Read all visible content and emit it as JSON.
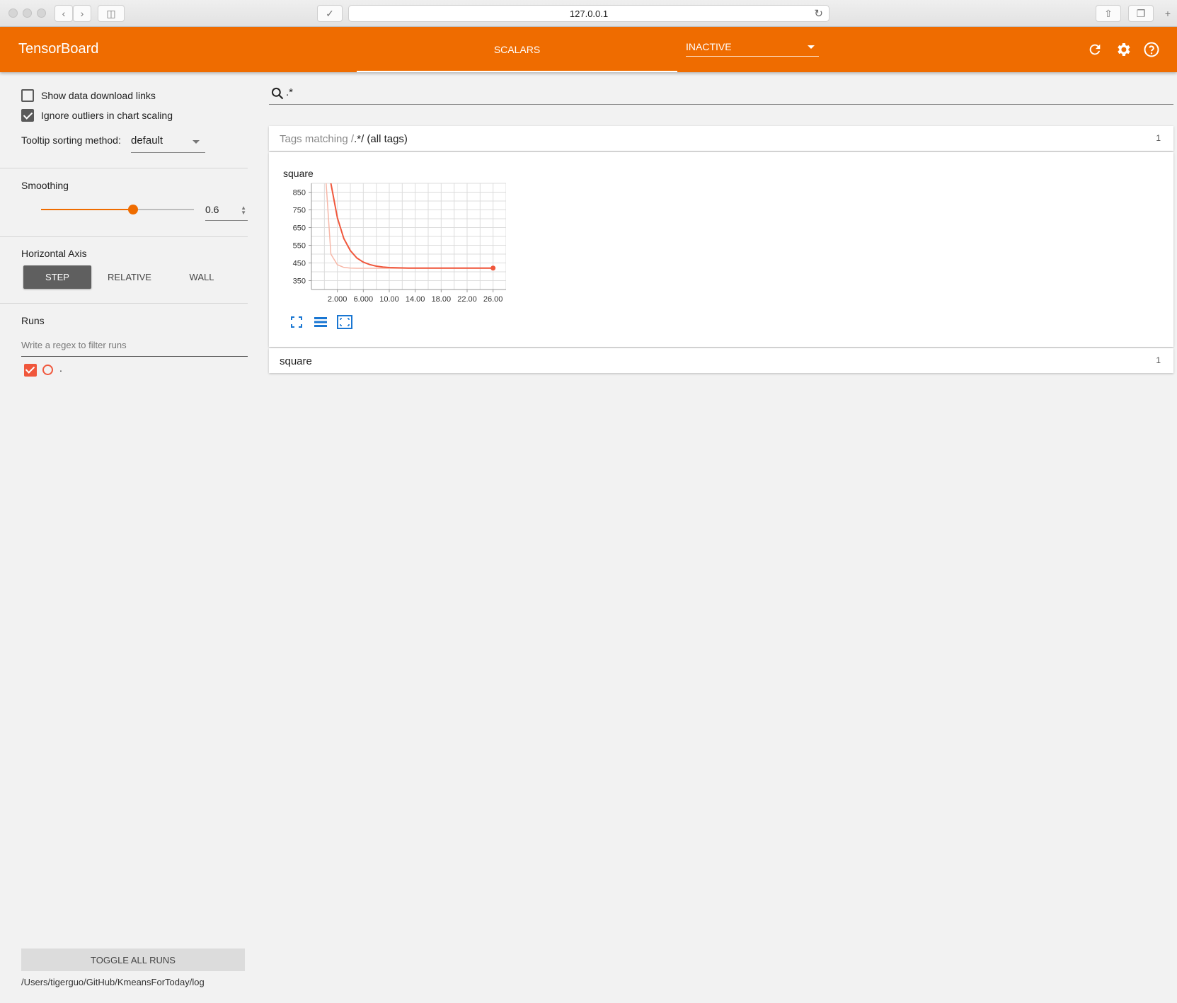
{
  "browser": {
    "url": "127.0.0.1"
  },
  "header": {
    "title": "TensorBoard",
    "tab": "SCALARS",
    "inactive_label": "INACTIVE",
    "accent": "#ef6c00"
  },
  "sidebar": {
    "show_download_label": "Show data download links",
    "show_download_checked": false,
    "ignore_outliers_label": "Ignore outliers in chart scaling",
    "ignore_outliers_checked": true,
    "tooltip_label": "Tooltip sorting method:",
    "tooltip_value": "default",
    "smoothing_title": "Smoothing",
    "smoothing_value": "0.6",
    "smoothing_fraction": 0.6,
    "axis_title": "Horizontal Axis",
    "axis_options": [
      "STEP",
      "RELATIVE",
      "WALL"
    ],
    "axis_selected": "STEP",
    "runs_title": "Runs",
    "runs_placeholder": "Write a regex to filter runs",
    "run_name": ".",
    "run_color": "#f0573c",
    "toggle_label": "TOGGLE ALL RUNS",
    "logdir": "/Users/tigerguo/GitHub/KmeansForToday/log"
  },
  "main": {
    "search_value": ".*",
    "group1": {
      "prefix": "Tags matching /",
      "regex": ".*",
      "suffix": "/ (all tags)",
      "count": "1"
    },
    "card_title": "square",
    "group2": {
      "title": "square",
      "count": "1"
    }
  },
  "chart_data": {
    "type": "line",
    "title": "square",
    "x_ticks": [
      "2.000",
      "6.000",
      "10.00",
      "14.00",
      "18.00",
      "22.00",
      "26.00"
    ],
    "y_ticks": [
      "850",
      "750",
      "650",
      "550",
      "450",
      "350"
    ],
    "xlim": [
      -2,
      28
    ],
    "ylim": [
      300,
      900
    ],
    "series": [
      {
        "role": "smoothed",
        "color": "#f0573c",
        "x": [
          0,
          1,
          2,
          3,
          4,
          5,
          6,
          7,
          8,
          9,
          10,
          11,
          12,
          13,
          14,
          15,
          16,
          17,
          18,
          19,
          20,
          21,
          22,
          23,
          24,
          25,
          26
        ],
        "y": [
          1050,
          900,
          705,
          588,
          520,
          478,
          455,
          441,
          432,
          427,
          424,
          423,
          422,
          421,
          421,
          421,
          421,
          421,
          421,
          421,
          421,
          421,
          421,
          421,
          421,
          421,
          421
        ]
      },
      {
        "role": "raw",
        "color": "#f7b7a8",
        "x": [
          0,
          1,
          2,
          3,
          4,
          5,
          6,
          7,
          8,
          9,
          10,
          11,
          12,
          13,
          14,
          15,
          16,
          17,
          18,
          19,
          20,
          21,
          22,
          23,
          24,
          25,
          26
        ],
        "y": [
          1050,
          500,
          440,
          425,
          421,
          420,
          420,
          420,
          420,
          420,
          420,
          420,
          420,
          420,
          420,
          420,
          420,
          420,
          420,
          420,
          420,
          420,
          420,
          420,
          420,
          420,
          420
        ]
      }
    ],
    "grid": true
  }
}
